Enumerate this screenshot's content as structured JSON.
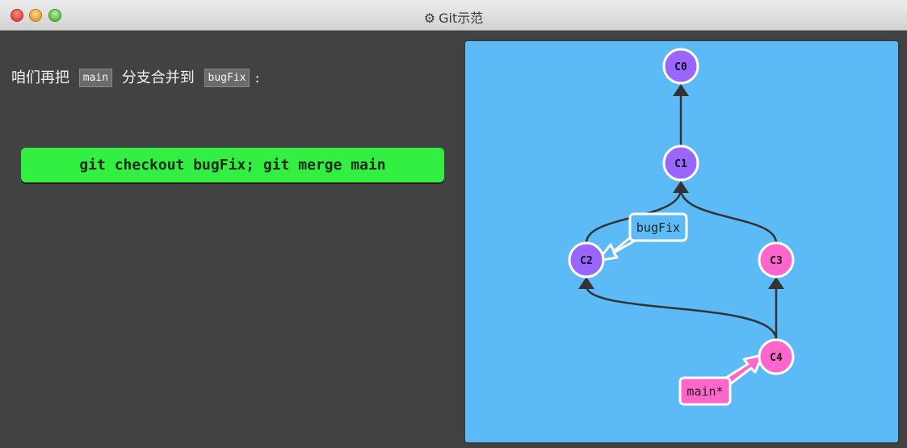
{
  "window": {
    "title": "Git示范",
    "title_icon": "gear-icon"
  },
  "instruction": {
    "prefix": "咱们再把",
    "branch_a": "main",
    "middle": "分支合并到",
    "branch_b": "bugFix",
    "suffix": ":"
  },
  "command": {
    "label": "git checkout bugFix; git merge main",
    "color": "#33ef42"
  },
  "graph": {
    "background": "#5cbaf7",
    "commits": [
      {
        "id": "C0",
        "color": "#9966ff"
      },
      {
        "id": "C1",
        "color": "#9966ff"
      },
      {
        "id": "C2",
        "color": "#9966ff"
      },
      {
        "id": "C3",
        "color": "#ff66cc"
      },
      {
        "id": "C4",
        "color": "#ff66cc"
      }
    ],
    "branches": [
      {
        "name": "bugFix",
        "target": "C2",
        "color": "#5cbaf7"
      },
      {
        "name": "main*",
        "target": "C4",
        "color": "#ff66cc"
      }
    ]
  }
}
